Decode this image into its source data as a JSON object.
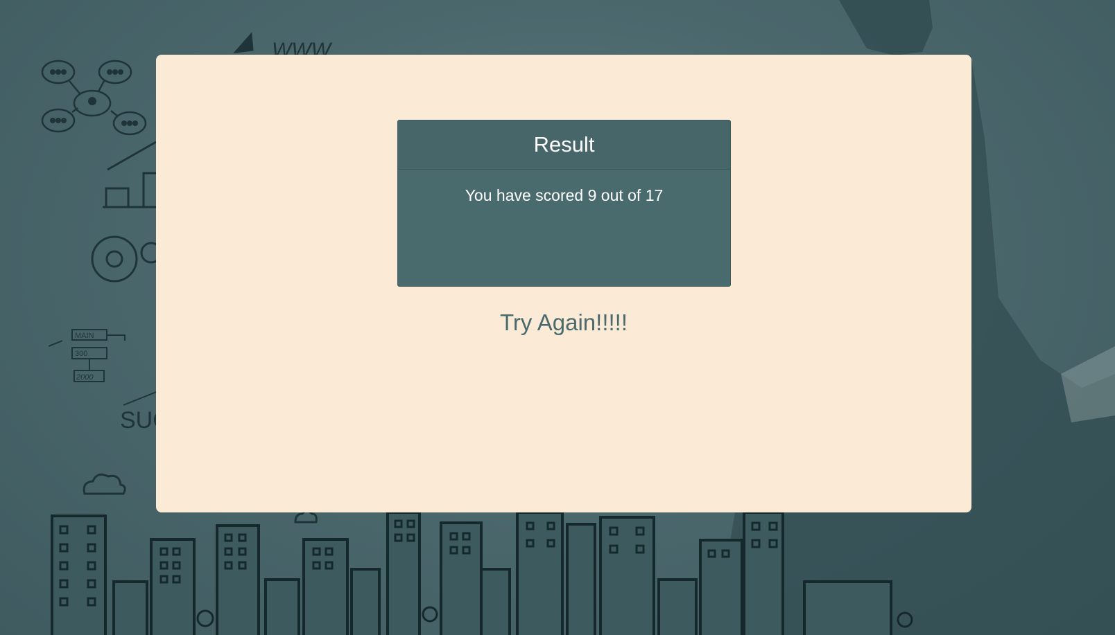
{
  "page": {
    "background_color": "#4b686d",
    "accent_color": "#4a6b6e",
    "modal_color": "#fbebd6"
  },
  "background_art": {
    "sketch_labels": {
      "www": "WWW",
      "main": "MAIN",
      "value_300": "300",
      "value_2000": "2000",
      "success": "SUC"
    }
  },
  "result": {
    "title": "Result",
    "score_text": "You have scored 9 out of 17",
    "message": "Try Again!!!!!"
  }
}
